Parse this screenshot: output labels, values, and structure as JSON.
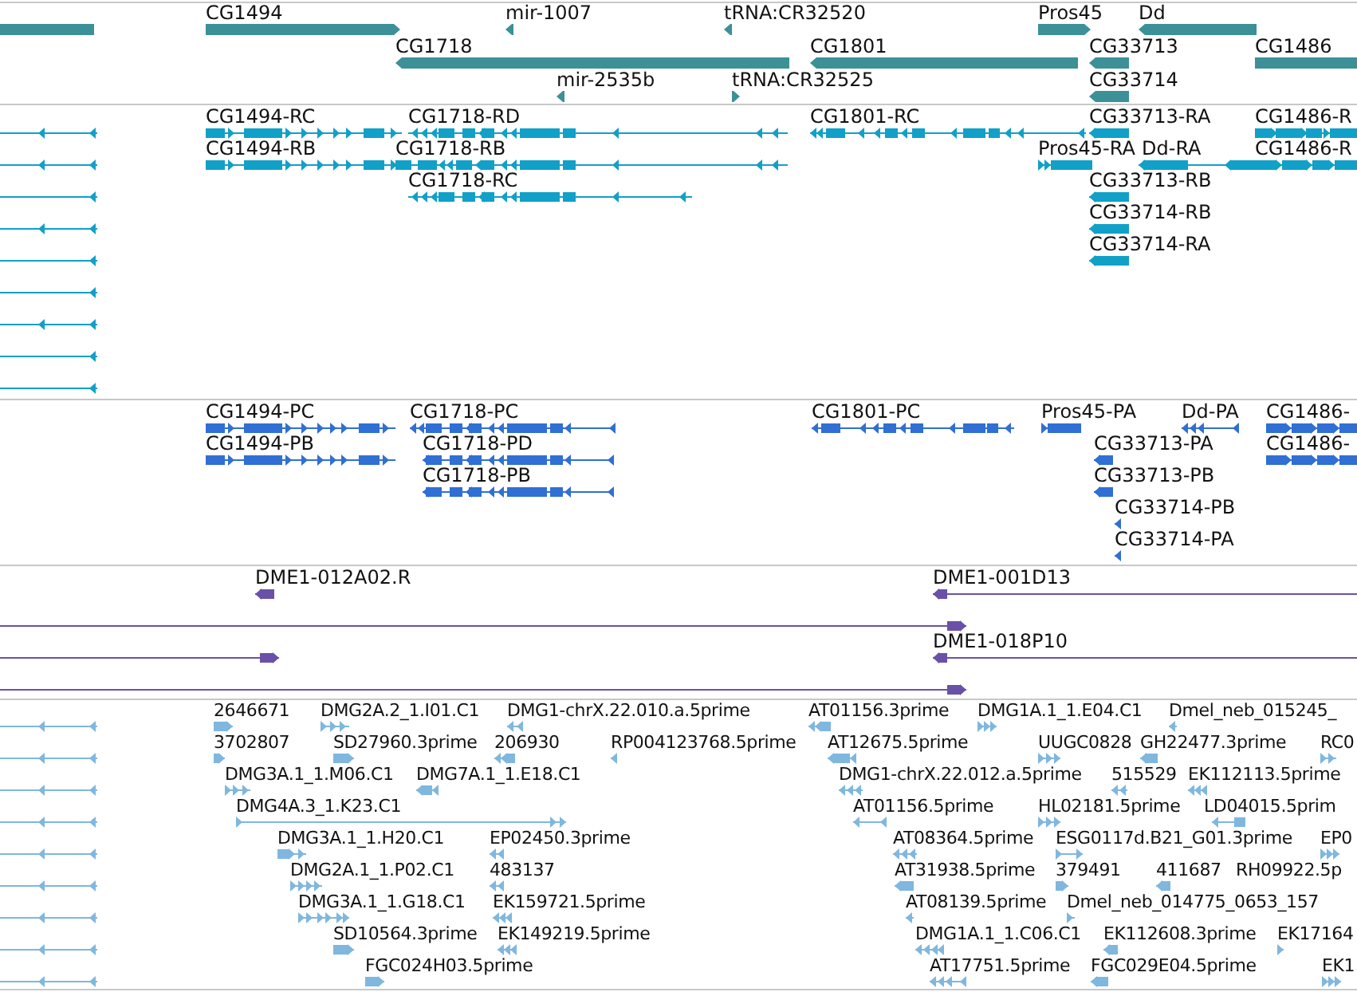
{
  "tracks": [
    {
      "kind": "bar",
      "color": "#3b9197",
      "features": [
        {
          "reverse": true
        },
        {
          "label": "CG1494",
          "reverse": false
        },
        {
          "label": "mir-1007",
          "reverse": true
        },
        {
          "label": "tRNA:CR32520",
          "reverse": true
        },
        {
          "label": "Pros45",
          "reverse": false
        },
        {
          "label": "Dd",
          "reverse": true
        },
        {
          "label": "CG1718",
          "reverse": true
        },
        {
          "label": "CG1801",
          "reverse": true
        },
        {
          "label": "CG33713",
          "reverse": true
        },
        {
          "label": "CG1486",
          "reverse": false
        },
        {
          "label": "mir-2535b",
          "reverse": true
        },
        {
          "label": "tRNA:CR32525",
          "reverse": false
        },
        {
          "label": "CG33714",
          "reverse": true
        }
      ]
    },
    {
      "kind": "segmented",
      "color": "#11a0c8",
      "features": [
        {
          "reverse": true
        },
        {
          "label": "CG1494-RC",
          "reverse": false
        },
        {
          "label": "CG1718-RD",
          "reverse": true
        },
        {
          "label": "CG1801-RC",
          "reverse": true
        },
        {
          "label": "CG33713-RA",
          "reverse": true
        },
        {
          "label": "CG1486-R",
          "reverse": false
        },
        {
          "reverse": true
        },
        {
          "label": "CG1494-RB",
          "reverse": false
        },
        {
          "label": "CG1718-RB",
          "reverse": true
        },
        {
          "label": "Pros45-RA",
          "reverse": false
        },
        {
          "label": "Dd-RA",
          "reverse": true
        },
        {
          "label": "CG1486-R",
          "reverse": false
        },
        {
          "reverse": true
        },
        {
          "label": "CG1718-RC",
          "reverse": true
        },
        {
          "label": "CG33713-RB",
          "reverse": true
        },
        {
          "reverse": true
        },
        {
          "label": "CG33714-RB",
          "reverse": true
        },
        {
          "reverse": true
        },
        {
          "label": "CG33714-RA",
          "reverse": true
        },
        {
          "reverse": true
        },
        {
          "reverse": true
        },
        {
          "reverse": true
        },
        {
          "reverse": true
        }
      ]
    },
    {
      "kind": "segmented",
      "color": "#306fd3",
      "features": [
        {
          "label": "CG1494-PC",
          "reverse": false
        },
        {
          "label": "CG1718-PC",
          "reverse": true
        },
        {
          "label": "CG1801-PC",
          "reverse": true
        },
        {
          "label": "Pros45-PA",
          "reverse": false
        },
        {
          "label": "Dd-PA",
          "reverse": true
        },
        {
          "label": "CG1486-",
          "reverse": false
        },
        {
          "label": "CG1494-PB",
          "reverse": false
        },
        {
          "label": "CG1718-PD",
          "reverse": true
        },
        {
          "label": "CG33713-PA",
          "reverse": true
        },
        {
          "label": "CG1486-",
          "reverse": false
        },
        {
          "label": "CG1718-PB",
          "reverse": true
        },
        {
          "label": "CG33713-PB",
          "reverse": true
        },
        {
          "label": "CG33714-PB",
          "reverse": true
        },
        {
          "label": "CG33714-PA",
          "reverse": true
        }
      ]
    },
    {
      "kind": "segmented",
      "color": "#6b50a8",
      "features": [
        {
          "label": "DME1-012A02.R",
          "reverse": true
        },
        {
          "label": "DME1-001D13",
          "reverse": true
        },
        {
          "reverse": false
        },
        {
          "reverse": false
        },
        {
          "label": "DME1-018P10",
          "reverse": true
        },
        {
          "reverse": false
        }
      ]
    },
    {
      "kind": "segmented",
      "color": "#7fb7de",
      "features": [
        {
          "reverse": true
        },
        {
          "label": "2646671",
          "reverse": false
        },
        {
          "label": "DMG2A.2_1.I01.C1",
          "reverse": false
        },
        {
          "label": "DMG1-chrX.22.010.a.5prime",
          "reverse": true
        },
        {
          "label": "AT01156.3prime",
          "reverse": true
        },
        {
          "label": "DMG1A.1_1.E04.C1",
          "reverse": false
        },
        {
          "label": "Dmel_neb_015245_",
          "reverse": true
        },
        {
          "reverse": true
        },
        {
          "label": "3702807",
          "reverse": false
        },
        {
          "label": "SD27960.3prime",
          "reverse": false
        },
        {
          "label": "206930",
          "reverse": true
        },
        {
          "label": "RP004123768.5prime",
          "reverse": true
        },
        {
          "label": "AT12675.5prime",
          "reverse": true
        },
        {
          "label": "UUGC0828",
          "reverse": false
        },
        {
          "label": "GH22477.3prime",
          "reverse": true
        },
        {
          "label": "RC0",
          "reverse": false
        },
        {
          "reverse": true
        },
        {
          "label": "DMG3A.1_1.M06.C1",
          "reverse": false
        },
        {
          "label": "DMG7A.1_1.E18.C1",
          "reverse": true
        },
        {
          "label": "DMG1-chrX.22.012.a.5prime",
          "reverse": true
        },
        {
          "label": "515529",
          "reverse": true
        },
        {
          "label": "EK112113.5prime",
          "reverse": true
        },
        {
          "reverse": true
        },
        {
          "label": "DMG4A.3_1.K23.C1",
          "reverse": false
        },
        {
          "label": "AT01156.5prime",
          "reverse": true
        },
        {
          "label": "HL02181.5prime",
          "reverse": false
        },
        {
          "label": "LD04015.5prim",
          "reverse": true
        },
        {
          "reverse": true
        },
        {
          "label": "DMG3A.1_1.H20.C1",
          "reverse": false
        },
        {
          "label": "EP02450.3prime",
          "reverse": true
        },
        {
          "label": "AT08364.5prime",
          "reverse": true
        },
        {
          "label": "ESG0117d.B21_G01.3prime",
          "reverse": false
        },
        {
          "label": "EP0",
          "reverse": false
        },
        {
          "reverse": true
        },
        {
          "label": "DMG2A.1_1.P02.C1",
          "reverse": false
        },
        {
          "label": "483137",
          "reverse": true
        },
        {
          "label": "AT31938.5prime",
          "reverse": true
        },
        {
          "label": "379491",
          "reverse": false
        },
        {
          "label": "411687",
          "reverse": true
        },
        {
          "label": "RH09922.5p"
        },
        {
          "reverse": true
        },
        {
          "label": "DMG3A.1_1.G18.C1",
          "reverse": false
        },
        {
          "label": "EK159721.5prime",
          "reverse": true
        },
        {
          "label": "AT08139.5prime",
          "reverse": true
        },
        {
          "label": "Dmel_neb_014775_0653_157",
          "reverse": false
        },
        {
          "reverse": true
        },
        {
          "label": "SD10564.3prime",
          "reverse": false
        },
        {
          "label": "EK149219.5prime",
          "reverse": true
        },
        {
          "label": "DMG1A.1_1.C06.C1",
          "reverse": true
        },
        {
          "label": "EK112608.3prime",
          "reverse": true
        },
        {
          "label": "EK17164",
          "reverse": false
        },
        {
          "reverse": true
        },
        {
          "label": "FGC024H03.5prime",
          "reverse": false
        },
        {
          "label": "AT17751.5prime",
          "reverse": true
        },
        {
          "label": "FGC029E04.5prime",
          "reverse": true
        },
        {
          "label": "EK1",
          "reverse": false
        }
      ]
    }
  ]
}
